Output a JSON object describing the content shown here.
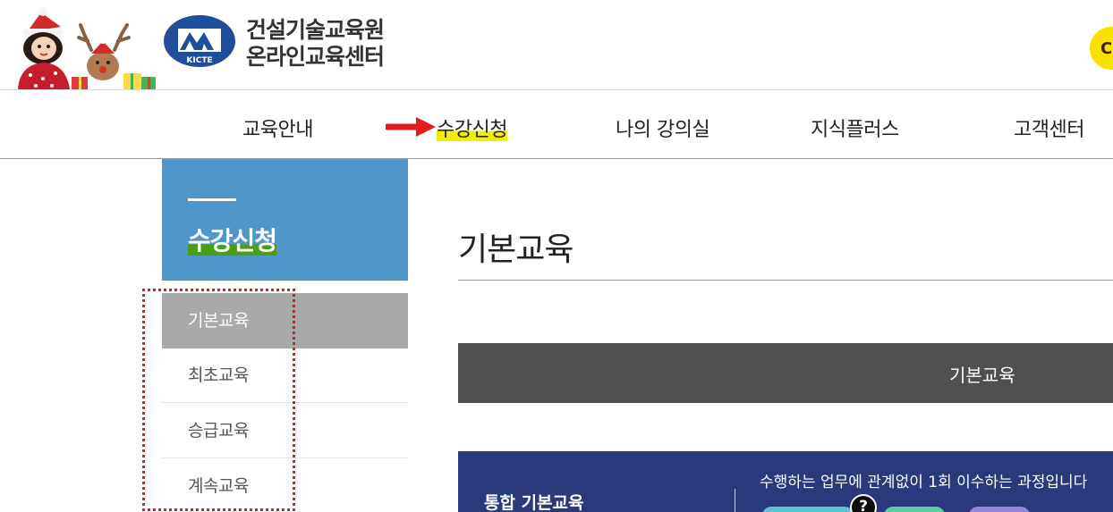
{
  "header": {
    "logo_emblem_text": "KICTE",
    "logo_line1": "건설기술교육원",
    "logo_line2": "온라인교육센터",
    "kakao_icon": "kakao-talk-icon"
  },
  "nav": {
    "items": [
      "교육안내",
      "수강신청",
      "나의 강의실",
      "지식플러스",
      "고객센터"
    ],
    "active_index": 1
  },
  "sidebar": {
    "title": "수강신청",
    "items": [
      "기본교육",
      "최초교육",
      "승급교육",
      "계속교육"
    ],
    "active_index": 0
  },
  "main": {
    "page_title": "기본교육",
    "section_bar_label": "기본교육",
    "course": {
      "name": "통합 기본교육",
      "description": "수행하는 업무에 관계없이 1회 이수하는 과정입니다",
      "help_icon": "question-icon"
    }
  },
  "colors": {
    "sidebar_title_bg": "#4f96cb",
    "active_side_item_bg": "#a9a9a9",
    "section_bar_bg": "#505050",
    "course_panel_bg": "#283a7c",
    "nav_highlight": "#f2ee00",
    "annotation_red": "#e31b1b"
  }
}
